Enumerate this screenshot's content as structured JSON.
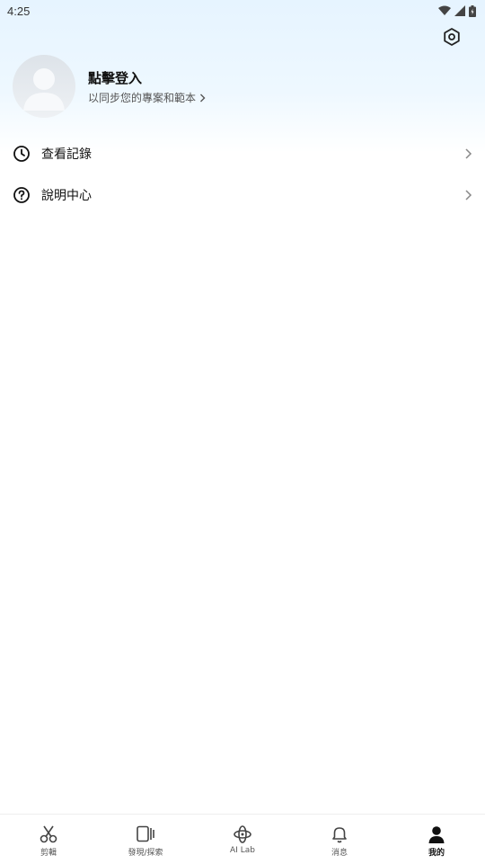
{
  "status_bar": {
    "time": "4:25"
  },
  "profile": {
    "title": "點擊登入",
    "subtitle": "以同步您的專案和範本"
  },
  "menu": [
    {
      "icon": "clock-icon",
      "label": "查看記錄"
    },
    {
      "icon": "help-circle-icon",
      "label": "說明中心"
    }
  ],
  "bottom_nav": [
    {
      "icon": "scissors-icon",
      "label": "剪輯",
      "active": false
    },
    {
      "icon": "discover-icon",
      "label": "發現/探索",
      "active": false
    },
    {
      "icon": "ai-lab-icon",
      "label": "AI Lab",
      "active": false
    },
    {
      "icon": "bell-icon",
      "label": "消息",
      "active": false
    },
    {
      "icon": "person-icon",
      "label": "我的",
      "active": true
    }
  ],
  "colors": {
    "header_gradient_top": "#e6f4ff",
    "text": "#111111",
    "muted": "#555555"
  }
}
